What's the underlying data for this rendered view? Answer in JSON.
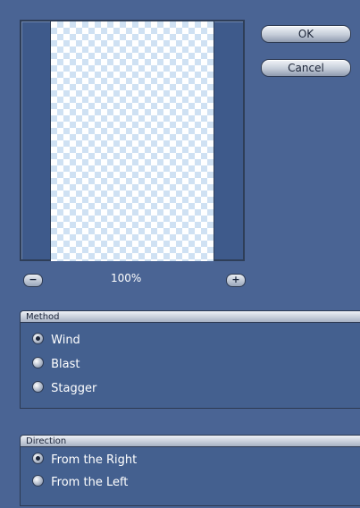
{
  "dialog": {
    "ok_label": "OK",
    "cancel_label": "Cancel"
  },
  "preview": {
    "zoom_text": "100%",
    "zoom_out_symbol": "−",
    "zoom_in_symbol": "+"
  },
  "method": {
    "title": "Method",
    "options": [
      {
        "label": "Wind",
        "selected": true
      },
      {
        "label": "Blast",
        "selected": false
      },
      {
        "label": "Stagger",
        "selected": false
      }
    ]
  },
  "direction": {
    "title": "Direction",
    "options": [
      {
        "label": "From the Right",
        "selected": true
      },
      {
        "label": "From the Left",
        "selected": false
      }
    ]
  },
  "colors": {
    "background": "#4a6494",
    "checker_light": "#cfe1f3"
  }
}
